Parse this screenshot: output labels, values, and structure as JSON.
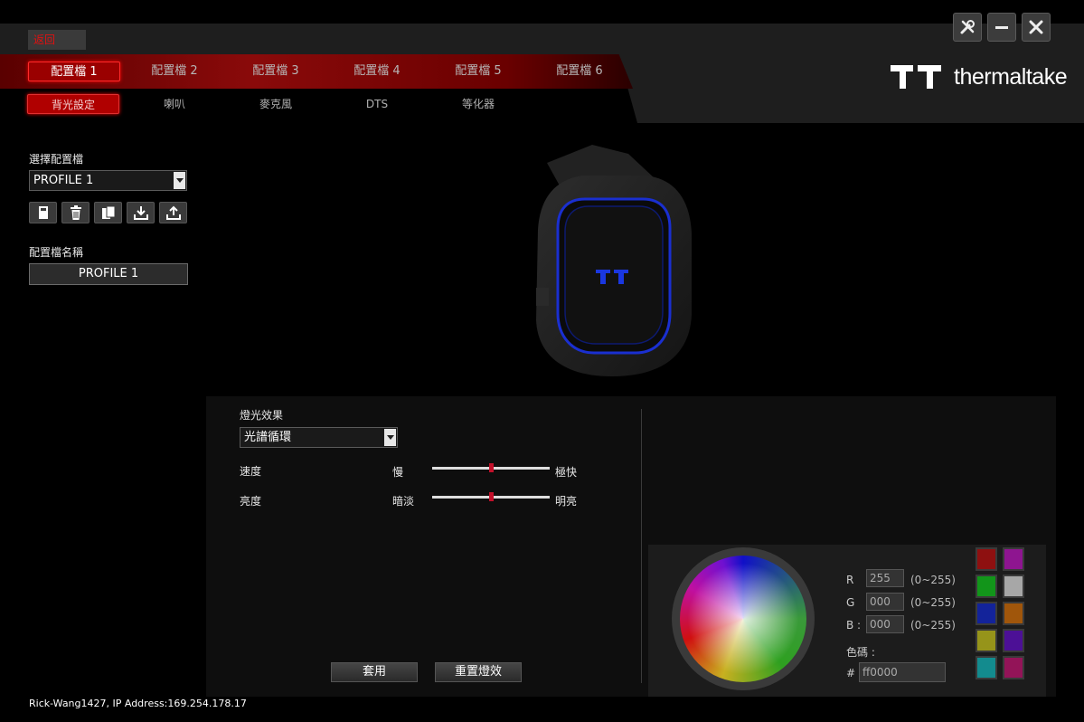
{
  "header": {
    "back_label": "返回",
    "profile_tabs": [
      "配置檔 1",
      "配置檔 2",
      "配置檔 3",
      "配置檔 4",
      "配置檔 5",
      "配置檔 6"
    ],
    "sub_tabs": [
      "背光設定",
      "喇叭",
      "麥克風",
      "DTS",
      "等化器"
    ],
    "brand": "thermaltake"
  },
  "left": {
    "select_label": "選擇配置檔",
    "selected_profile": "PROFILE 1",
    "tools": [
      "save-icon",
      "delete-icon",
      "copy-icon",
      "import-icon",
      "export-icon"
    ],
    "name_label": "配置檔名稱",
    "name_value": "PROFILE 1"
  },
  "lighting": {
    "effect_label": "燈光效果",
    "effect_value": "光譜循環",
    "speed_label": "速度",
    "speed_min": "慢",
    "speed_max": "極快",
    "speed_level": 0.5,
    "brightness_label": "亮度",
    "brightness_min": "暗淡",
    "brightness_max": "明亮",
    "brightness_level": 0.5,
    "apply_label": "套用",
    "reset_label": "重置燈效"
  },
  "color": {
    "r_label": "R",
    "g_label": "G",
    "b_label": "B :",
    "r_value": "255",
    "g_value": "000",
    "b_value": "000",
    "range": "(0~255)",
    "code_label": "色碼 :",
    "hash": "#",
    "hex_value": "ff0000",
    "swatches": [
      "#8e1010",
      "#8e1590",
      "#12951a",
      "#a7a7a7",
      "#13239a",
      "#a0560b",
      "#96941a",
      "#4c1096",
      "#138b8e",
      "#931458"
    ]
  },
  "status": "Rick-Wang1427, IP Address:169.254.178.17"
}
